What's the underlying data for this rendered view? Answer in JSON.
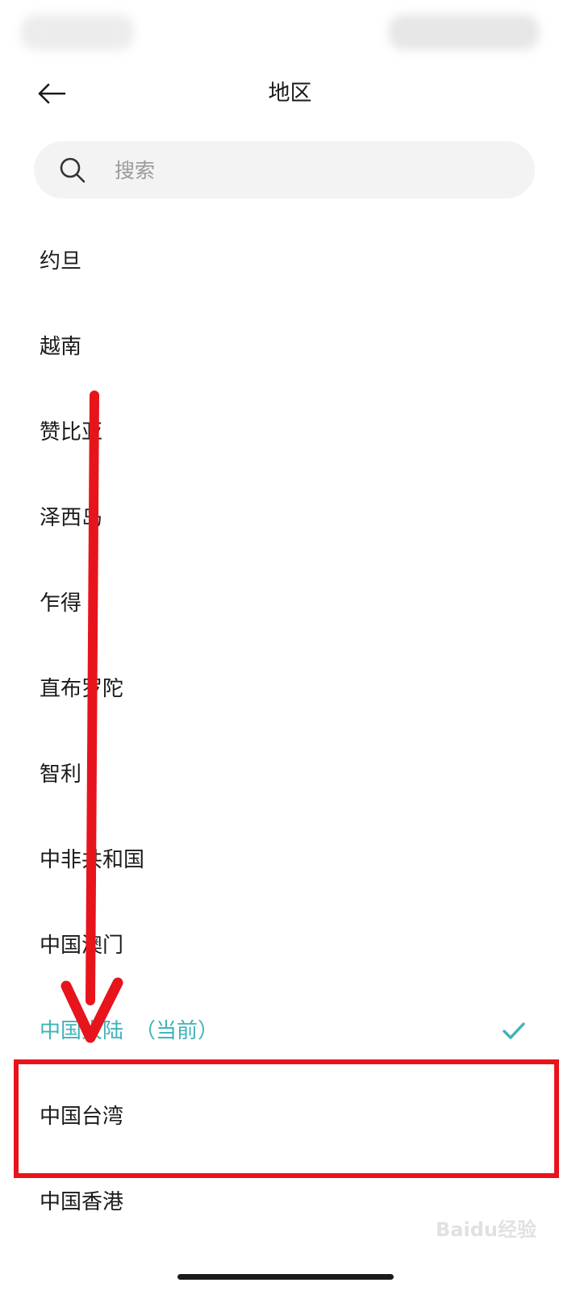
{
  "header": {
    "title": "地区",
    "back_icon": "arrow-left-icon"
  },
  "search": {
    "placeholder": "搜索",
    "value": "",
    "icon": "search-icon"
  },
  "regions": {
    "items": [
      {
        "label": "约旦"
      },
      {
        "label": "越南"
      },
      {
        "label": "赞比亚"
      },
      {
        "label": "泽西岛"
      },
      {
        "label": "乍得"
      },
      {
        "label": "直布罗陀"
      },
      {
        "label": "智利"
      },
      {
        "label": "中非共和国"
      },
      {
        "label": "中国澳门"
      },
      {
        "label": "中国大陆",
        "suffix": "（当前）",
        "current": true
      },
      {
        "label": "中国台湾",
        "highlighted": true
      },
      {
        "label": "中国香港"
      }
    ]
  },
  "colors": {
    "accent": "#3fb3b8",
    "annotation": "#e8141c"
  },
  "watermark": {
    "text": "Baidu经验"
  }
}
